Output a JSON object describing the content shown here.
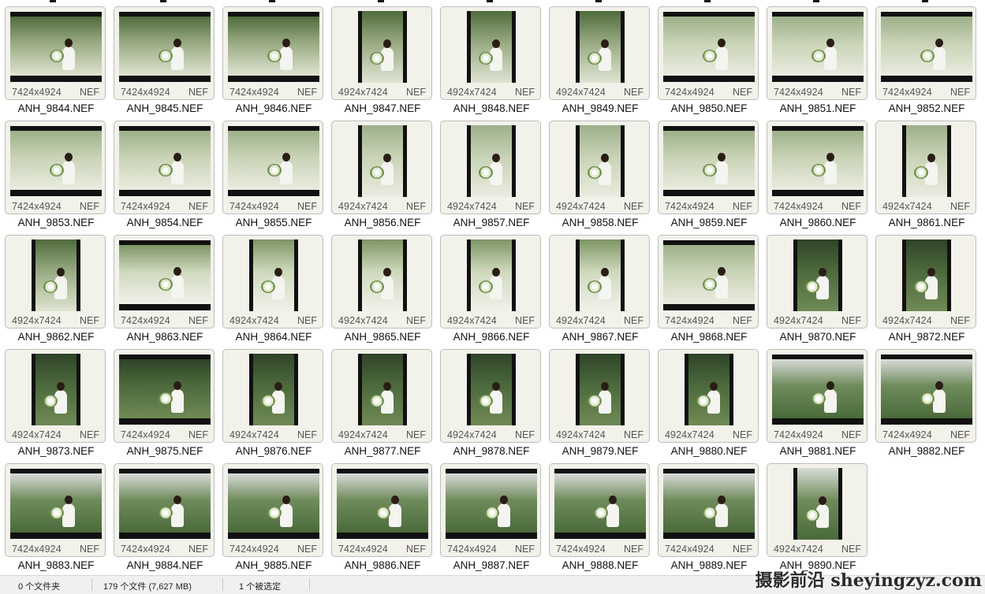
{
  "files": [
    {
      "name": "ANH_9844.NEF",
      "dims": "7424x4924",
      "ext": "NEF",
      "orient": "land",
      "tone": "greenbw"
    },
    {
      "name": "ANH_9845.NEF",
      "dims": "7424x4924",
      "ext": "NEF",
      "orient": "land",
      "tone": "greenbw"
    },
    {
      "name": "ANH_9846.NEF",
      "dims": "7424x4924",
      "ext": "NEF",
      "orient": "land",
      "tone": "greenbw"
    },
    {
      "name": "ANH_9847.NEF",
      "dims": "4924x7424",
      "ext": "NEF",
      "orient": "port",
      "tone": "greenbw"
    },
    {
      "name": "ANH_9848.NEF",
      "dims": "4924x7424",
      "ext": "NEF",
      "orient": "port",
      "tone": "greenbw"
    },
    {
      "name": "ANH_9849.NEF",
      "dims": "4924x7424",
      "ext": "NEF",
      "orient": "port",
      "tone": "greenbw"
    },
    {
      "name": "ANH_9850.NEF",
      "dims": "7424x4924",
      "ext": "NEF",
      "orient": "land",
      "tone": "field"
    },
    {
      "name": "ANH_9851.NEF",
      "dims": "7424x4924",
      "ext": "NEF",
      "orient": "land",
      "tone": "field"
    },
    {
      "name": "ANH_9852.NEF",
      "dims": "7424x4924",
      "ext": "NEF",
      "orient": "land",
      "tone": "field"
    },
    {
      "name": "ANH_9853.NEF",
      "dims": "7424x4924",
      "ext": "NEF",
      "orient": "land",
      "tone": "field"
    },
    {
      "name": "ANH_9854.NEF",
      "dims": "7424x4924",
      "ext": "NEF",
      "orient": "land",
      "tone": "field"
    },
    {
      "name": "ANH_9855.NEF",
      "dims": "7424x4924",
      "ext": "NEF",
      "orient": "land",
      "tone": "field"
    },
    {
      "name": "ANH_9856.NEF",
      "dims": "4924x7424",
      "ext": "NEF",
      "orient": "port",
      "tone": "field"
    },
    {
      "name": "ANH_9857.NEF",
      "dims": "4924x7424",
      "ext": "NEF",
      "orient": "port",
      "tone": "field"
    },
    {
      "name": "ANH_9858.NEF",
      "dims": "4924x7424",
      "ext": "NEF",
      "orient": "port",
      "tone": "field"
    },
    {
      "name": "ANH_9859.NEF",
      "dims": "7424x4924",
      "ext": "NEF",
      "orient": "land",
      "tone": "field"
    },
    {
      "name": "ANH_9860.NEF",
      "dims": "7424x4924",
      "ext": "NEF",
      "orient": "land",
      "tone": "field"
    },
    {
      "name": "ANH_9861.NEF",
      "dims": "4924x7424",
      "ext": "NEF",
      "orient": "port",
      "tone": "field"
    },
    {
      "name": "ANH_9862.NEF",
      "dims": "4924x7424",
      "ext": "NEF",
      "orient": "port",
      "tone": "greenbw"
    },
    {
      "name": "ANH_9863.NEF",
      "dims": "7424x4924",
      "ext": "NEF",
      "orient": "land",
      "tone": "crown"
    },
    {
      "name": "ANH_9864.NEF",
      "dims": "4924x7424",
      "ext": "NEF",
      "orient": "port",
      "tone": "crown"
    },
    {
      "name": "ANH_9865.NEF",
      "dims": "4924x7424",
      "ext": "NEF",
      "orient": "port",
      "tone": "crown"
    },
    {
      "name": "ANH_9866.NEF",
      "dims": "4924x7424",
      "ext": "NEF",
      "orient": "port",
      "tone": "crown"
    },
    {
      "name": "ANH_9867.NEF",
      "dims": "4924x7424",
      "ext": "NEF",
      "orient": "port",
      "tone": "crown"
    },
    {
      "name": "ANH_9868.NEF",
      "dims": "7424x4924",
      "ext": "NEF",
      "orient": "land",
      "tone": "field"
    },
    {
      "name": "ANH_9870.NEF",
      "dims": "4924x7424",
      "ext": "NEF",
      "orient": "port",
      "tone": "dark"
    },
    {
      "name": "ANH_9872.NEF",
      "dims": "4924x7424",
      "ext": "NEF",
      "orient": "port",
      "tone": "dark"
    },
    {
      "name": "ANH_9873.NEF",
      "dims": "4924x7424",
      "ext": "NEF",
      "orient": "port",
      "tone": "dark"
    },
    {
      "name": "ANH_9875.NEF",
      "dims": "7424x4924",
      "ext": "NEF",
      "orient": "land",
      "tone": "dark"
    },
    {
      "name": "ANH_9876.NEF",
      "dims": "4924x7424",
      "ext": "NEF",
      "orient": "port",
      "tone": "dark"
    },
    {
      "name": "ANH_9877.NEF",
      "dims": "4924x7424",
      "ext": "NEF",
      "orient": "port",
      "tone": "dark"
    },
    {
      "name": "ANH_9878.NEF",
      "dims": "4924x7424",
      "ext": "NEF",
      "orient": "port",
      "tone": "dark"
    },
    {
      "name": "ANH_9879.NEF",
      "dims": "4924x7424",
      "ext": "NEF",
      "orient": "port",
      "tone": "dark"
    },
    {
      "name": "ANH_9880.NEF",
      "dims": "4924x7424",
      "ext": "NEF",
      "orient": "port",
      "tone": "dark"
    },
    {
      "name": "ANH_9881.NEF",
      "dims": "7424x4924",
      "ext": "NEF",
      "orient": "land",
      "tone": "garden"
    },
    {
      "name": "ANH_9882.NEF",
      "dims": "7424x4924",
      "ext": "NEF",
      "orient": "land",
      "tone": "garden"
    },
    {
      "name": "ANH_9883.NEF",
      "dims": "7424x4924",
      "ext": "NEF",
      "orient": "land",
      "tone": "garden"
    },
    {
      "name": "ANH_9884.NEF",
      "dims": "7424x4924",
      "ext": "NEF",
      "orient": "land",
      "tone": "garden"
    },
    {
      "name": "ANH_9885.NEF",
      "dims": "7424x4924",
      "ext": "NEF",
      "orient": "land",
      "tone": "garden"
    },
    {
      "name": "ANH_9886.NEF",
      "dims": "7424x4924",
      "ext": "NEF",
      "orient": "land",
      "tone": "garden"
    },
    {
      "name": "ANH_9887.NEF",
      "dims": "7424x4924",
      "ext": "NEF",
      "orient": "land",
      "tone": "garden"
    },
    {
      "name": "ANH_9888.NEF",
      "dims": "7424x4924",
      "ext": "NEF",
      "orient": "land",
      "tone": "garden"
    },
    {
      "name": "ANH_9889.NEF",
      "dims": "7424x4924",
      "ext": "NEF",
      "orient": "land",
      "tone": "garden"
    },
    {
      "name": "ANH_9890.NEF",
      "dims": "4924x7424",
      "ext": "NEF",
      "orient": "port",
      "tone": "garden"
    }
  ],
  "tones": {
    "greenbw": [
      "#4f6b3c",
      "#9aab84",
      "#dfe4d2"
    ],
    "field": [
      "#9db08a",
      "#c9d3b6",
      "#e9ece0"
    ],
    "crown": [
      "#7d9564",
      "#cfd9bd",
      "#f1f2ea"
    ],
    "dark": [
      "#2e4428",
      "#4d6a3d",
      "#6f8a55"
    ],
    "garden": [
      "#d8dcd8",
      "#6f8b5c",
      "#4a6a3a"
    ]
  },
  "status": {
    "folders": "0 个文件夹",
    "files": "179 个文件 (7,627 MB)",
    "selected": "1 个被选定"
  },
  "watermark": "摄影前沿 sheyingzyz.com"
}
